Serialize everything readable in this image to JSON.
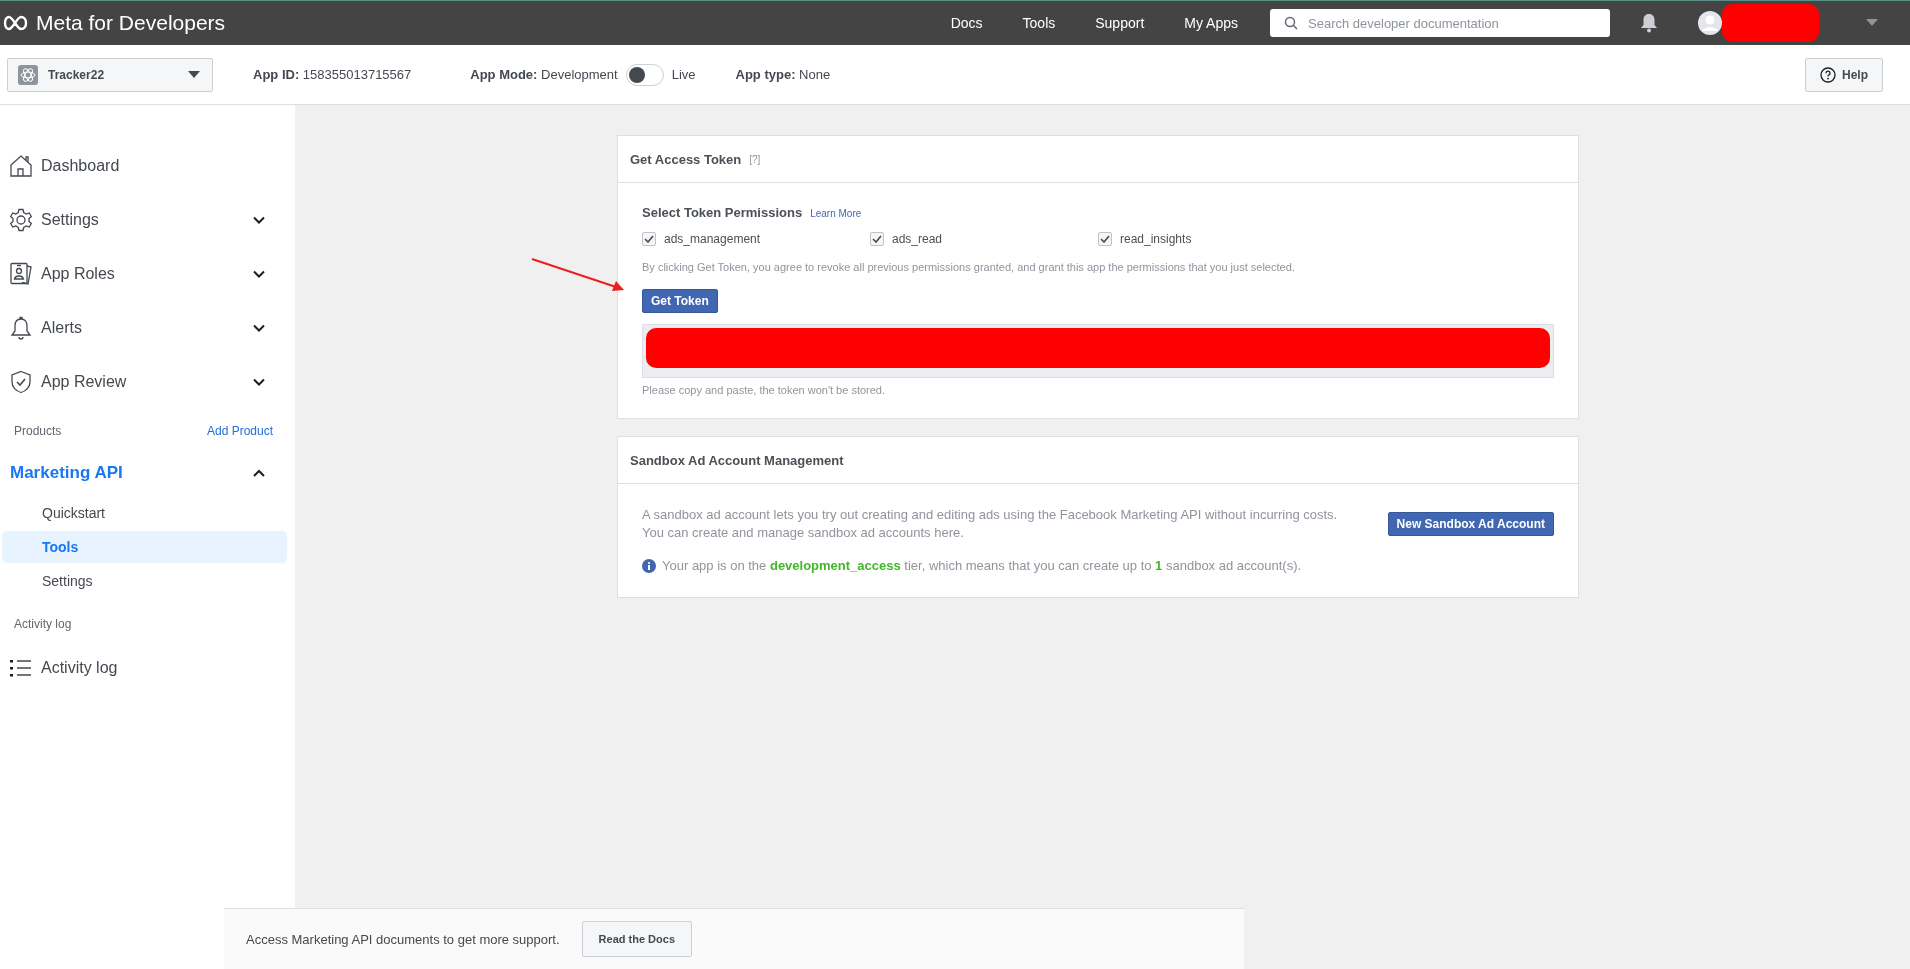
{
  "topbar": {
    "logo": "Meta for Developers",
    "nav": [
      "Docs",
      "Tools",
      "Support",
      "My Apps"
    ],
    "search": {
      "placeholder": "Search developer documentation"
    }
  },
  "appbar": {
    "app_name": "Tracker22",
    "app_id_label": "App ID:",
    "app_id": "158355013715567",
    "mode_label": "App Mode:",
    "mode_value": "Development",
    "live": {
      "label": "Live",
      "on": false
    },
    "type_label": "App type:",
    "type_value": "None",
    "help": "Help"
  },
  "sidebar": {
    "items": [
      {
        "label": "Dashboard"
      },
      {
        "label": "Settings",
        "expanded": false
      },
      {
        "label": "App Roles",
        "expanded": false
      },
      {
        "label": "Alerts",
        "expanded": false
      },
      {
        "label": "App Review",
        "expanded": false
      }
    ],
    "products_label": "Products",
    "add_product": "Add Product",
    "product": {
      "label": "Marketing API",
      "expanded": true,
      "children": [
        {
          "label": "Quickstart",
          "selected": false
        },
        {
          "label": "Tools",
          "selected": true
        },
        {
          "label": "Settings",
          "selected": false
        }
      ]
    },
    "activity_label": "Activity log",
    "activity_item": "Activity log"
  },
  "token_card": {
    "title": "Get Access Token",
    "help": "[?]",
    "permissions_title": "Select Token Permissions",
    "learn_more": "Learn More",
    "permissions": [
      {
        "label": "ads_management",
        "checked": true
      },
      {
        "label": "ads_read",
        "checked": true
      },
      {
        "label": "read_insights",
        "checked": true
      }
    ],
    "notice": "By clicking Get Token, you agree to revoke all previous permissions granted, and grant this app the permissions that you just selected.",
    "button": "Get Token",
    "hint": "Please copy and paste, the token won't be stored."
  },
  "sandbox_card": {
    "title": "Sandbox Ad Account Management",
    "description": "A sandbox ad account lets you try out creating and editing ads using the Facebook Marketing API without incurring costs. You can create and manage sandbox ad accounts here.",
    "button": "New Sandbox Ad Account",
    "info": "Your app is on the **development_access** tier, which means that you can create up to **1** sandbox ad account(s)."
  },
  "footer": {
    "text": "Access Marketing API documents to get more support.",
    "button": "Read the Docs"
  }
}
